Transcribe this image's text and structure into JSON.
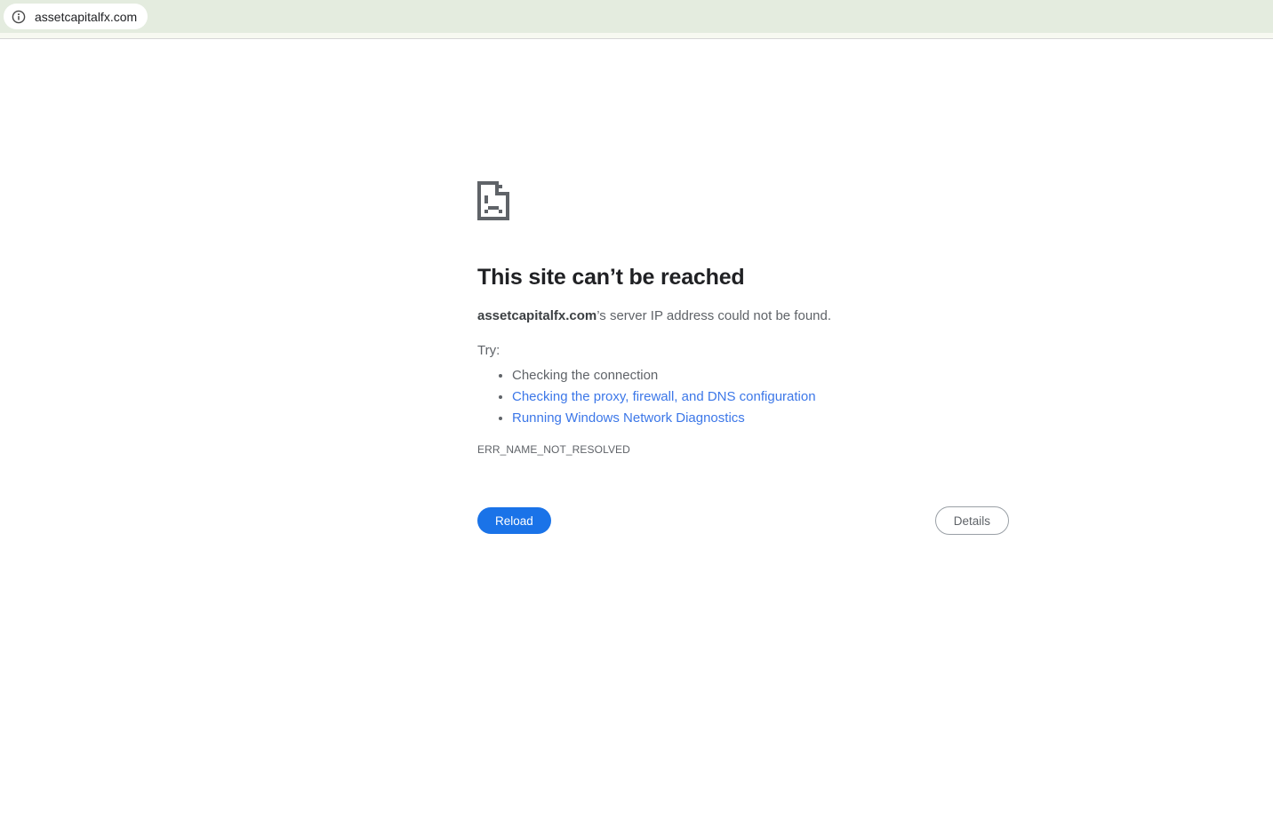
{
  "browser": {
    "address_bar": {
      "url": "assetcapitalfx.com"
    },
    "colors": {
      "toolbar": "#e4ecdf",
      "strip": "#f7f9f1",
      "divider": "#d6d6d6"
    }
  },
  "error_page": {
    "title": "This site can’t be reached",
    "domain": "assetcapitalfx.com",
    "message_suffix": "’s server IP address could not be found.",
    "try_label": "Try:",
    "suggestions": [
      {
        "label": "Checking the connection",
        "is_link": false
      },
      {
        "label": "Checking the proxy, firewall, and DNS configuration",
        "is_link": true
      },
      {
        "label": "Running Windows Network Diagnostics",
        "is_link": true
      }
    ],
    "error_code": "ERR_NAME_NOT_RESOLVED",
    "buttons": {
      "reload": "Reload",
      "details": "Details"
    },
    "colors": {
      "heading": "#202124",
      "body_text": "#5f6368",
      "link": "#3c77e8",
      "primary_button": "#1a73e8"
    }
  }
}
